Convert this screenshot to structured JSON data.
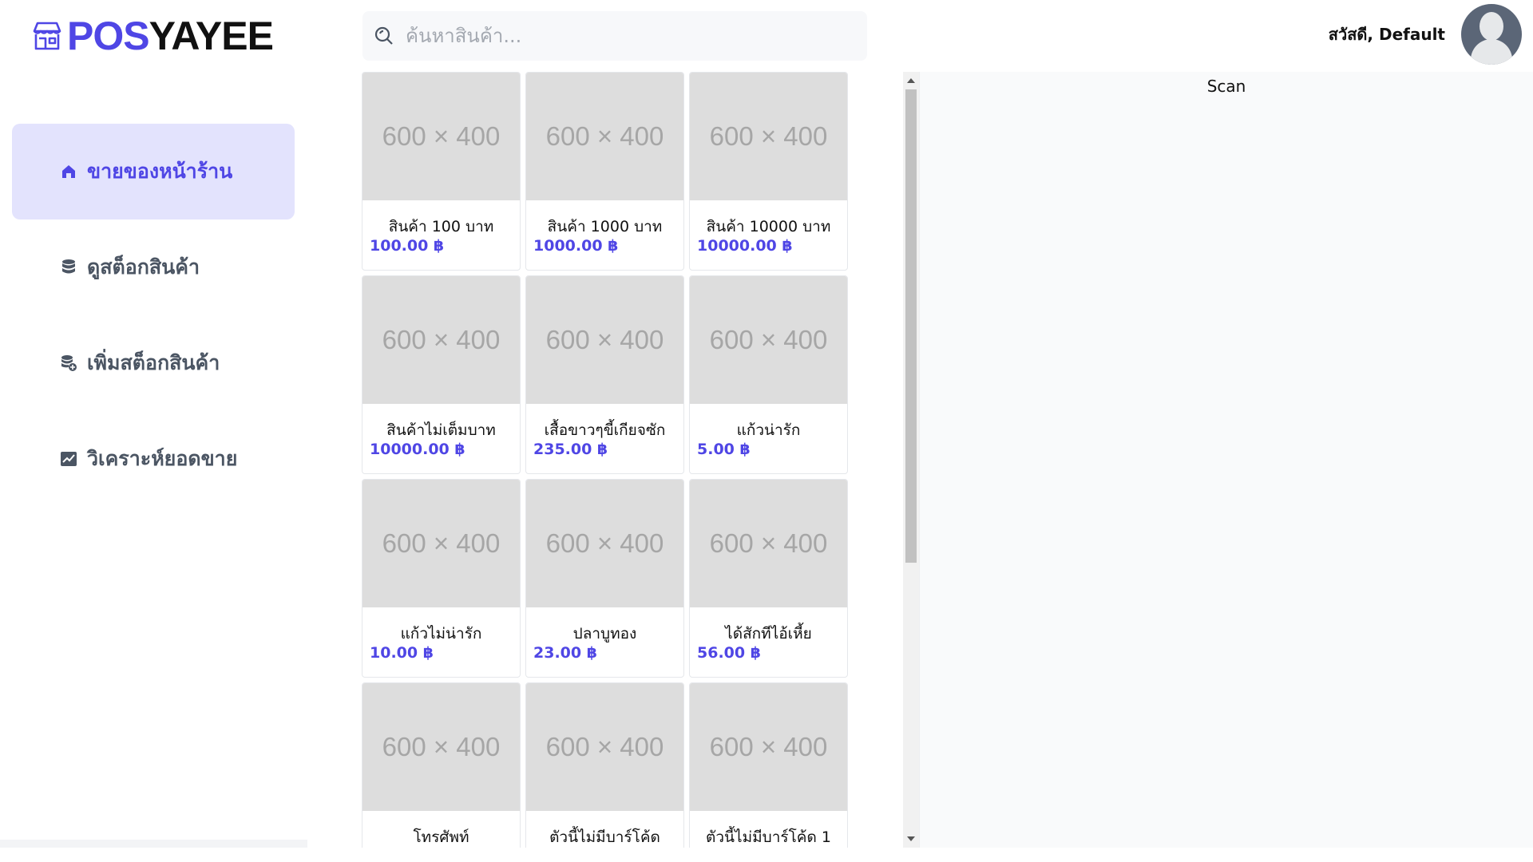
{
  "logo": {
    "pos": "POS",
    "rest": "YAYEE",
    "icon": "store-icon"
  },
  "sidebar": {
    "items": [
      {
        "label": "ขายของหน้าร้าน",
        "icon": "home-icon",
        "active": true
      },
      {
        "label": "ดูสต็อกสินค้า",
        "icon": "database-icon",
        "active": false
      },
      {
        "label": "เพิ่มสต็อกสินค้า",
        "icon": "database-add-icon",
        "active": false
      },
      {
        "label": "วิเคราะห์ยอดขาย",
        "icon": "chart-icon",
        "active": false
      }
    ]
  },
  "search": {
    "placeholder": "ค้นหาสินค้า..."
  },
  "user": {
    "greeting": "สวัสดี, Default"
  },
  "products": [
    {
      "image": "600 × 400",
      "name": "สินค้า 100 บาท",
      "price": "100.00 ฿"
    },
    {
      "image": "600 × 400",
      "name": "สินค้า 1000 บาท",
      "price": "1000.00 ฿"
    },
    {
      "image": "600 × 400",
      "name": "สินค้า 10000 บาท",
      "price": "10000.00 ฿"
    },
    {
      "image": "600 × 400",
      "name": "สินค้าไม่เต็มบาท",
      "price": "10000.00 ฿"
    },
    {
      "image": "600 × 400",
      "name": "เสื้อขาวๆขี้เกียจซัก",
      "price": "235.00 ฿"
    },
    {
      "image": "600 × 400",
      "name": "แก้วน่ารัก",
      "price": "5.00 ฿"
    },
    {
      "image": "600 × 400",
      "name": "แก้วไม่น่ารัก",
      "price": "10.00 ฿"
    },
    {
      "image": "600 × 400",
      "name": "ปลาบูทอง",
      "price": "23.00 ฿"
    },
    {
      "image": "600 × 400",
      "name": "ได้สักทีไอ้เหี้ย",
      "price": "56.00 ฿"
    },
    {
      "image": "600 × 400",
      "name": "โทรศัพท์",
      "price": ""
    },
    {
      "image": "600 × 400",
      "name": "ตัวนี้ไม่มีบาร์โค้ด",
      "price": ""
    },
    {
      "image": "600 × 400",
      "name": "ตัวนี้ไม่มีบาร์โค้ด 1",
      "price": ""
    }
  ],
  "scan": {
    "title": "Scan"
  },
  "colors": {
    "accent": "#4f46e5",
    "active_bg": "#e3e3fd",
    "placeholder_bg": "#dddddd"
  }
}
